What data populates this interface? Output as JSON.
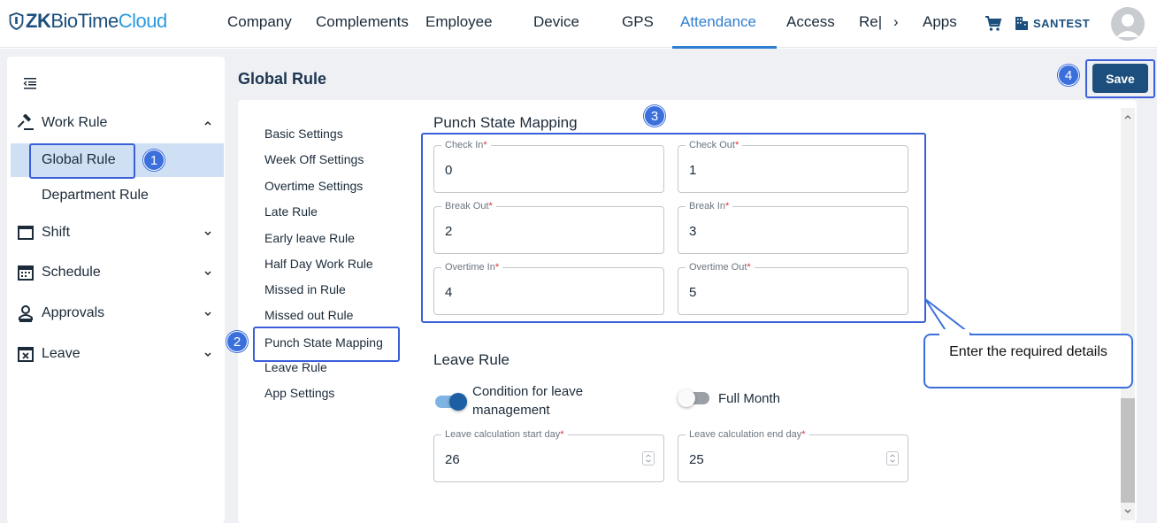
{
  "brand": {
    "part1": "ZK",
    "part2": "BioTime",
    "part3": "Cloud"
  },
  "nav": {
    "items": [
      "Company",
      "Complements",
      "Employee",
      "Device",
      "GPS",
      "Attendance",
      "Access",
      "Re|",
      "›",
      "Apps"
    ],
    "active": "Attendance",
    "tenant": "SANTEST"
  },
  "sidebar": {
    "work_rule": "Work Rule",
    "global_rule": "Global Rule",
    "department_rule": "Department Rule",
    "shift": "Shift",
    "schedule": "Schedule",
    "approvals": "Approvals",
    "leave": "Leave"
  },
  "page": {
    "title": "Global Rule",
    "save_label": "Save"
  },
  "subnav": [
    "Basic Settings",
    "Week Off Settings",
    "Overtime Settings",
    "Late Rule",
    "Early leave Rule",
    "Half Day Work Rule",
    "Missed in Rule",
    "Missed out Rule",
    "Punch State Mapping",
    "Leave Rule",
    "App Settings"
  ],
  "punch_state": {
    "title": "Punch State Mapping",
    "check_in": {
      "label": "Check In",
      "value": "0"
    },
    "check_out": {
      "label": "Check Out",
      "value": "1"
    },
    "break_out": {
      "label": "Break Out",
      "value": "2"
    },
    "break_in": {
      "label": "Break In",
      "value": "3"
    },
    "overtime_in": {
      "label": "Overtime In",
      "value": "4"
    },
    "overtime_out": {
      "label": "Overtime Out",
      "value": "5"
    }
  },
  "leave_rule": {
    "title": "Leave Rule",
    "condition_label": "Condition for leave management",
    "condition_on": true,
    "full_month_label": "Full Month",
    "full_month_on": false,
    "start_day": {
      "label": "Leave calculation start day",
      "value": "26"
    },
    "end_day": {
      "label": "Leave calculation end day",
      "value": "25"
    }
  },
  "required_mark": "*",
  "annotations": {
    "b1": "1",
    "b2": "2",
    "b3": "3",
    "b4": "4",
    "callout": "Enter the required details"
  },
  "colors": {
    "brand": "#1c4f7d",
    "accent": "#2f7fd0",
    "annotation": "#3b6fdb",
    "active_bg": "#cfe0f4"
  }
}
